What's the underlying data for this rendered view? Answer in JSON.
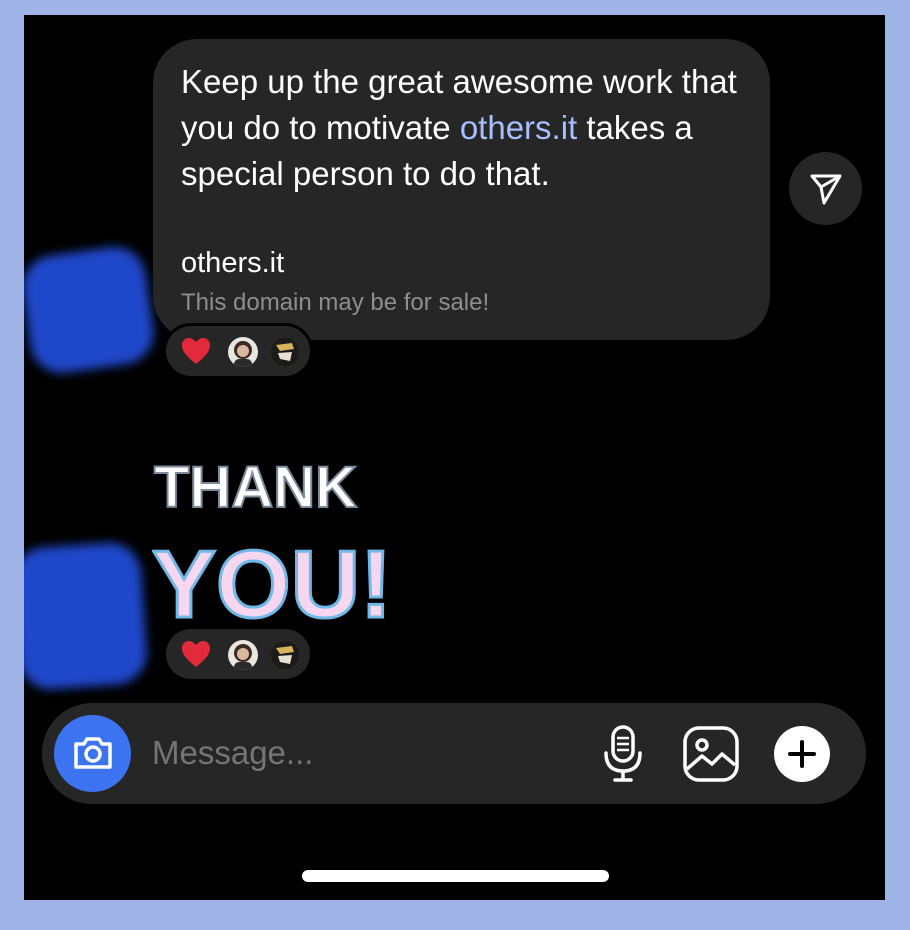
{
  "colors": {
    "frame": "#9fb3e6",
    "screen": "#000000",
    "bubble": "#262626",
    "link": "#a7bfff",
    "accent": "#3b73f0"
  },
  "message": {
    "text_before": "Keep up the great awesome work that you do to motivate ",
    "link": "others.it",
    "text_after": " takes a special person to do that.",
    "preview_title": "others.it",
    "preview_subtitle": "This domain may be for sale!"
  },
  "reactions": [
    {
      "emoji": "❤️",
      "icons": [
        "heart-icon",
        "avatar-1",
        "avatar-2"
      ]
    },
    {
      "emoji": "❤️",
      "icons": [
        "heart-icon",
        "avatar-1",
        "avatar-2"
      ]
    }
  ],
  "sticker": {
    "line1": "THANK",
    "line2": "YOU!"
  },
  "composer": {
    "placeholder": "Message...",
    "icons": [
      "camera-icon",
      "microphone-icon",
      "gallery-icon",
      "plus-icon"
    ]
  },
  "share_icon": "send-icon"
}
